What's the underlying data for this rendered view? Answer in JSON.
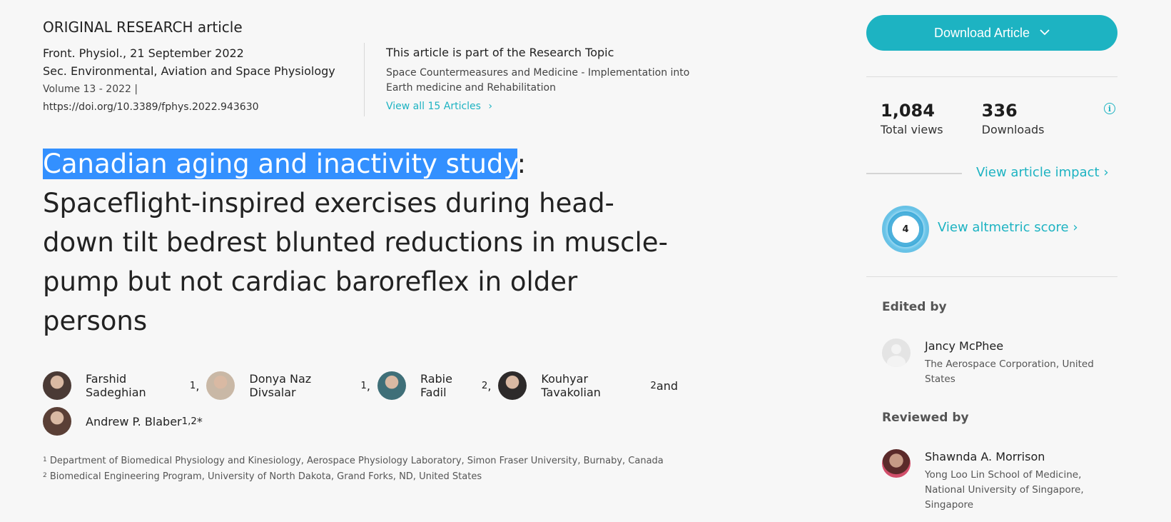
{
  "article": {
    "type": "ORIGINAL RESEARCH article",
    "journal_date": "Front. Physiol., 21 September 2022",
    "section": "Sec. Environmental, Aviation and Space Physiology",
    "volume": "Volume 13 - 2022 |",
    "doi": "https://doi.org/10.3389/fphys.2022.943630",
    "title_highlight": "Canadian aging and inactivity study",
    "title_rest": ": Spaceflight-inspired exercises during head-down tilt bedrest blunted reductions in muscle-pump but not cardiac baroreflex in older persons"
  },
  "topic": {
    "label": "This article is part of the Research Topic",
    "name": "Space Countermeasures and Medicine - Implementation into Earth medicine and Rehabilitation",
    "link": "View all 15 Articles"
  },
  "authors": [
    {
      "name": "Farshid Sadeghian",
      "sup": "1",
      "sep": ",",
      "color": "#4a3a35"
    },
    {
      "name": "Donya Naz Divsalar",
      "sup": "1",
      "sep": ",",
      "color": "#c9b8a6"
    },
    {
      "name": "Rabie Fadil",
      "sup": "2",
      "sep": ",",
      "color": "#3f6f78"
    },
    {
      "name": "Kouhyar Tavakolian",
      "sup": "2",
      "sep": " and",
      "color": "#2d2a2a"
    },
    {
      "name": "Andrew P. Blaber",
      "sup": "1,2",
      "sep": "*",
      "color": "#5a3f36"
    }
  ],
  "affiliations": [
    {
      "sup": "1",
      "text": "Department of Biomedical Physiology and Kinesiology, Aerospace Physiology Laboratory, Simon Fraser University, Burnaby, Canada"
    },
    {
      "sup": "2",
      "text": "Biomedical Engineering Program, University of North Dakota, Grand Forks, ND, United States"
    }
  ],
  "sidebar": {
    "download_label": "Download Article",
    "views_num": "1,084",
    "views_label": "Total views",
    "downloads_num": "336",
    "downloads_label": "Downloads",
    "impact_link": "View article impact",
    "altmetric_score": "4",
    "altmetric_link": "View altmetric score",
    "edited_by": "Edited by",
    "editor": {
      "name": "Jancy McPhee",
      "affiliation": "The Aerospace Corporation, United States"
    },
    "reviewed_by": "Reviewed by",
    "reviewer": {
      "name": "Shawnda A. Morrison",
      "affiliation": "Yong Loo Lin School of Medicine, National University of Singapore, Singapore"
    }
  },
  "colors": {
    "accent": "#1db3c2",
    "selection": "#3390ff"
  },
  "icons": {
    "download_chevron": "chevron-down-icon",
    "topic_chevron": "chevron-right-icon",
    "info": "info-icon"
  }
}
